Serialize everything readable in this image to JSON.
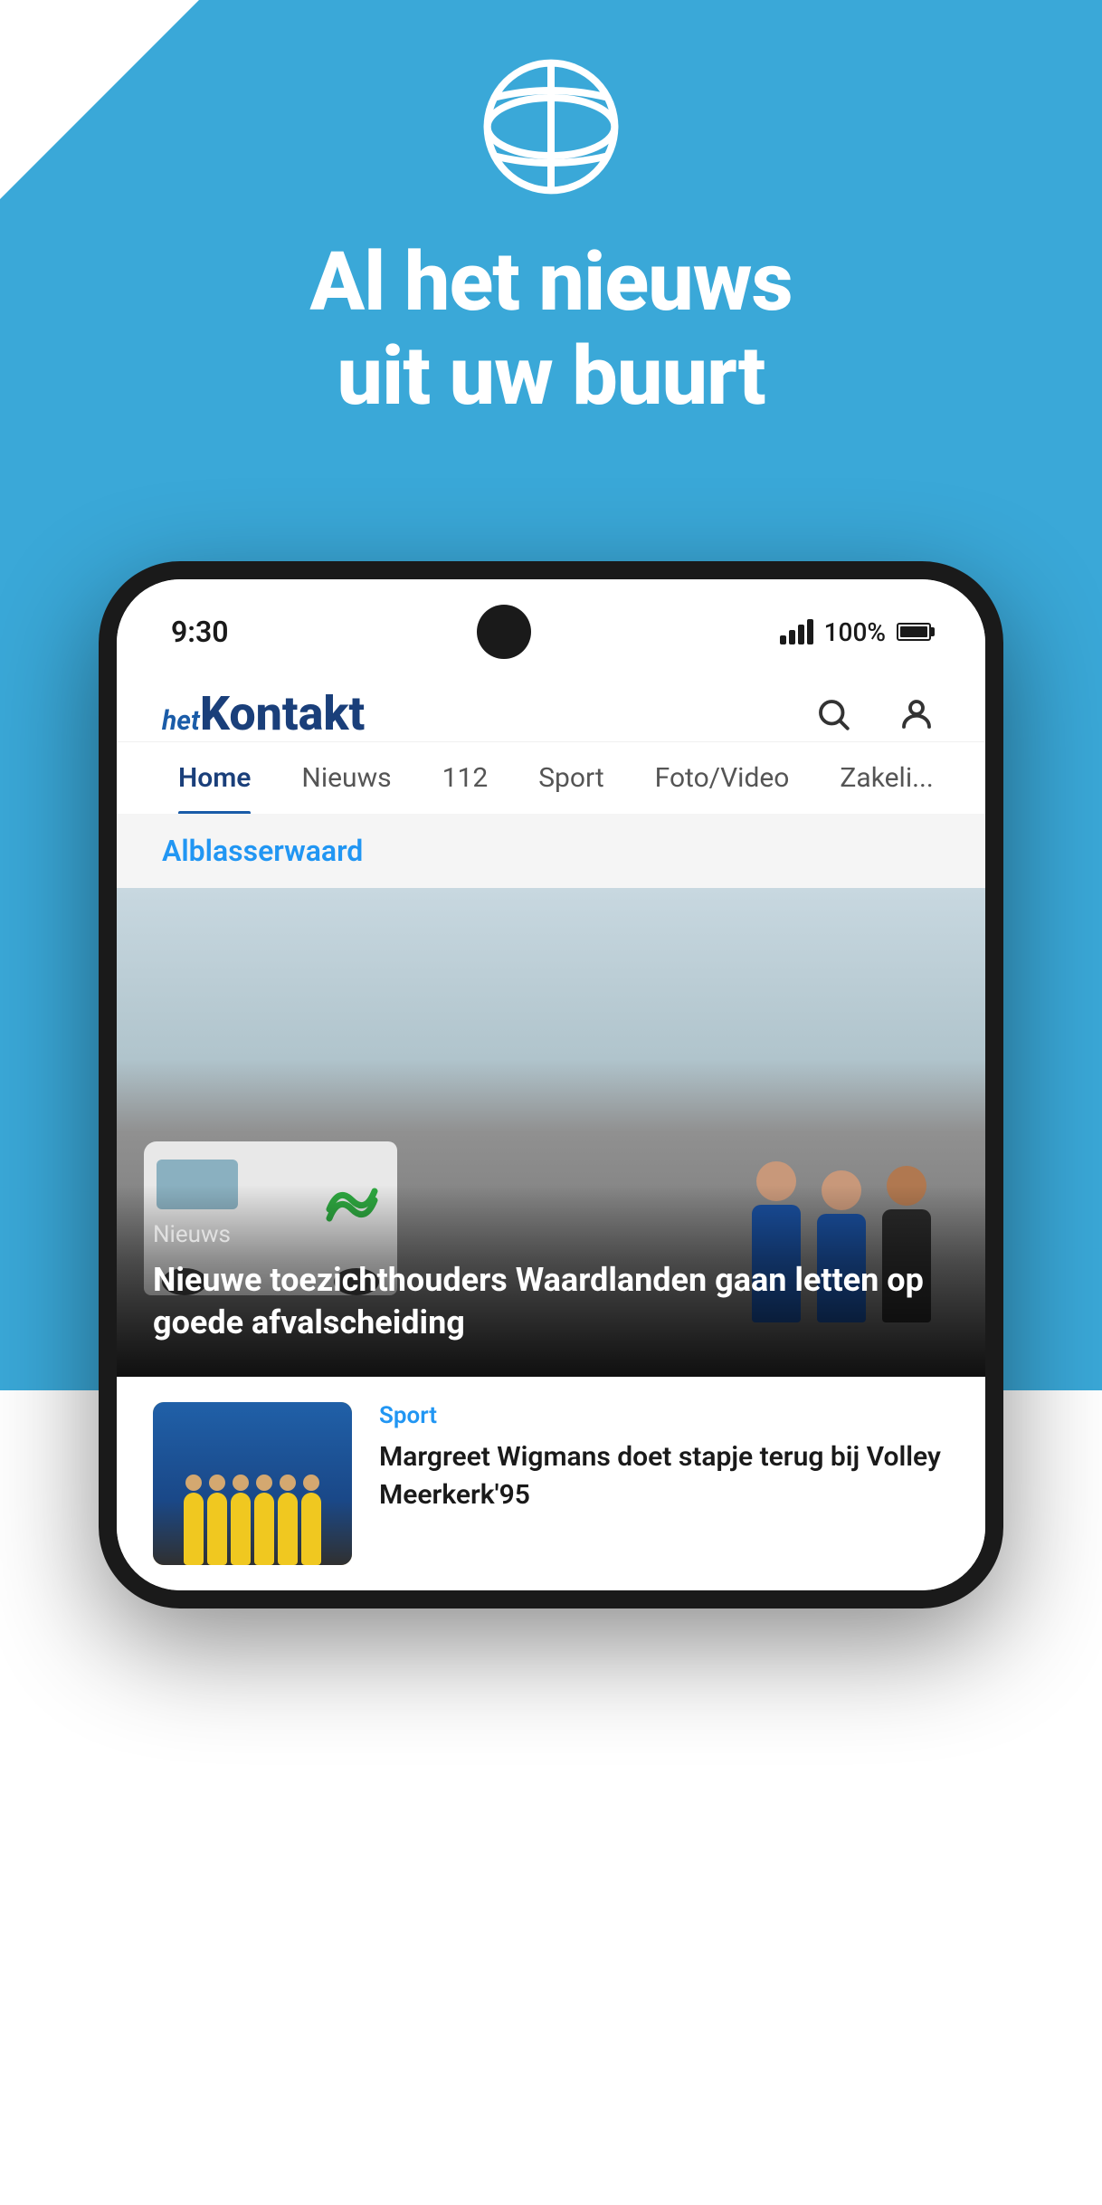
{
  "app": {
    "background_color": "#3aa8d8",
    "tagline_line1": "Al het nieuws",
    "tagline_line2": "uit uw buurt"
  },
  "phone": {
    "status_bar": {
      "time": "9:30",
      "signal_label": "signal",
      "battery_percent": "100%"
    },
    "header": {
      "logo_prefix": "het",
      "logo_name": "Kontakt",
      "search_icon": "search-icon",
      "profile_icon": "profile-icon"
    },
    "navigation": {
      "tabs": [
        {
          "label": "Home",
          "active": true
        },
        {
          "label": "Nieuws",
          "active": false
        },
        {
          "label": "112",
          "active": false
        },
        {
          "label": "Sport",
          "active": false
        },
        {
          "label": "Foto/Video",
          "active": false
        },
        {
          "label": "Zakelijk",
          "active": false
        }
      ]
    },
    "category_section": {
      "label": "Alblasserwaard"
    },
    "main_article": {
      "category": "Nieuws",
      "title": "Nieuwe toezichthouders Waardlanden gaan letten op goede afvalscheiding"
    },
    "second_article": {
      "category": "Sport",
      "title": "Margreet Wigmans doet stapje terug bij Volley Meerkerk'95"
    }
  }
}
